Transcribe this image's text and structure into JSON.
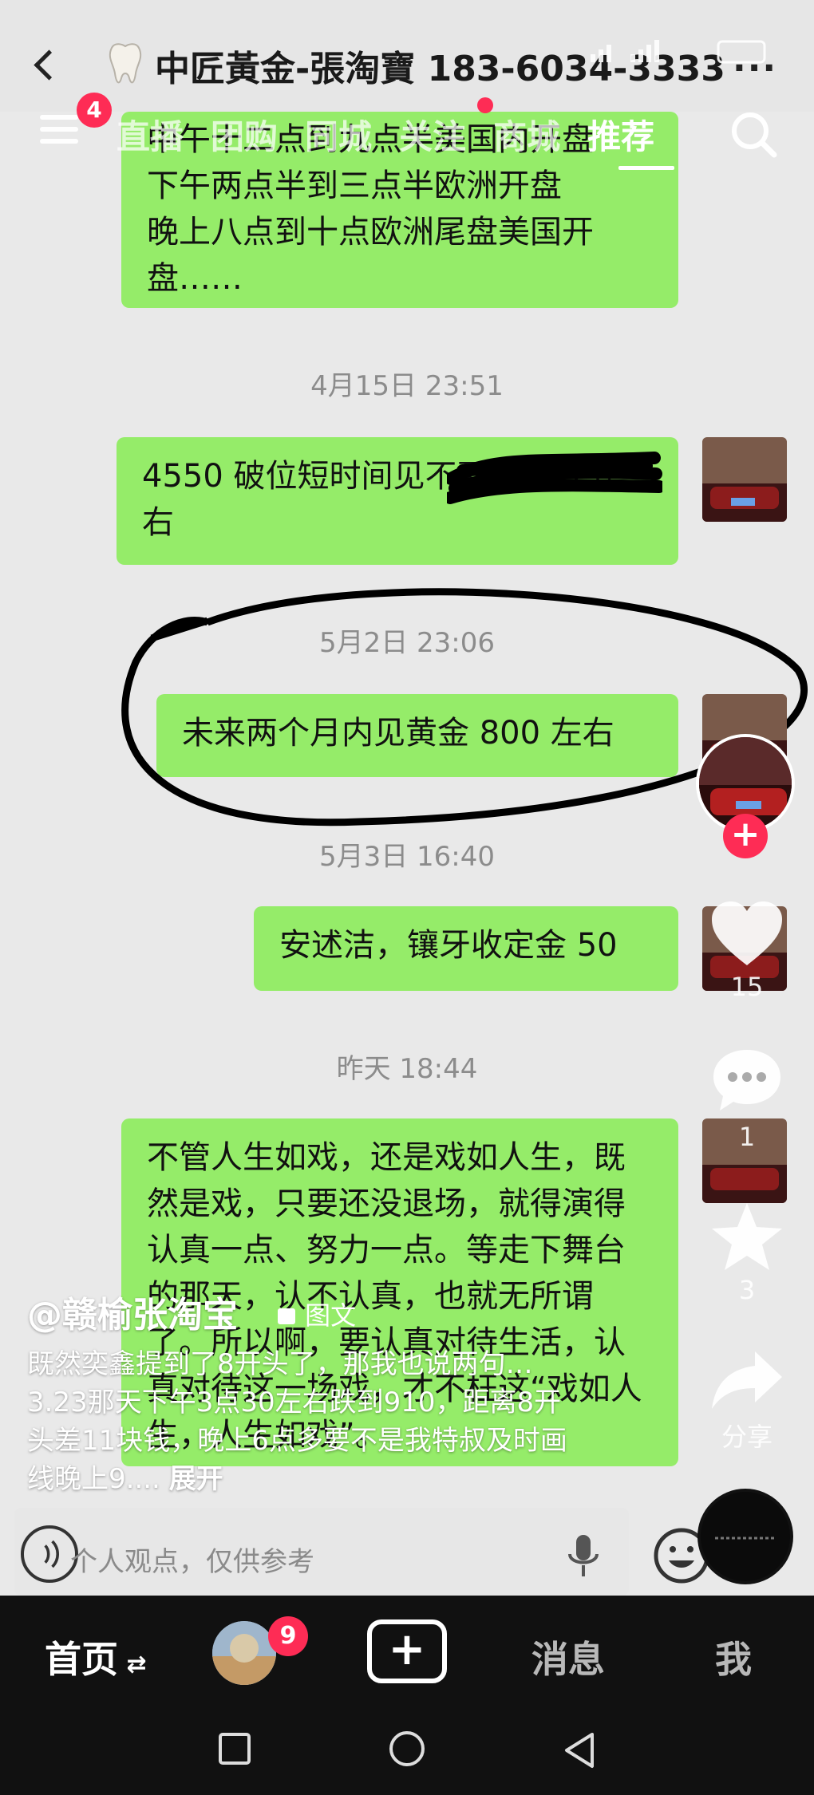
{
  "chat": {
    "title": "中匠黃金-張淘寶 183-6034-3333",
    "messages": [
      {
        "text": "中午十二点到九点半美国内开盘\n下午两点半到三点半欧洲开盘\n晚上八点到十点欧洲尾盘美国开盘……"
      },
      {
        "timestamp": "4月15日 23:51",
        "text": "4550 破位短时间见不到 4500 左右"
      },
      {
        "timestamp": "5月2日 23:06",
        "text": "未来两个月内见黄金 800 左右"
      },
      {
        "timestamp": "5月3日 16:40",
        "text": "安述洁，镶牙收定金 50"
      },
      {
        "timestamp": "昨天 18:44",
        "text": "不管人生如戏，还是戏如人生，既然是戏，只要还没退场，就得演得认真一点、努力一点。等走下舞台的那天，认不认真，也就无所谓了。所以啊，要认真对待生活，认真对待这一场戏，才不枉这“戏如人生，人生如戏”。"
      }
    ]
  },
  "nav": {
    "menu_badge": "4",
    "tabs": [
      "直播",
      "团购",
      "同城",
      "关注",
      "商城",
      "推荐"
    ],
    "active_tab": "推荐"
  },
  "rail": {
    "likes": "15",
    "comments": "1",
    "favorites": "3",
    "share_label": "分享"
  },
  "caption": {
    "author": "@赣榆张淘宝",
    "tag": "图文",
    "text": "既然奕鑫提到了8开头了，那我也说两句…3.23那天下午3点30左右跌到910，距离8开头差11块钱，晚上6点多要不是我特叔及时画线晚上9....",
    "expand": "展开"
  },
  "input": {
    "placeholder": "个人观点，仅供参考"
  },
  "tabbar": {
    "home": "首页",
    "friends_badge": "9",
    "messages": "消息",
    "me": "我"
  },
  "colors": {
    "bubble": "#95ec69",
    "accent": "#fe2c55",
    "chat_bg": "#e9e9e9",
    "tabbar_bg": "#111111"
  }
}
